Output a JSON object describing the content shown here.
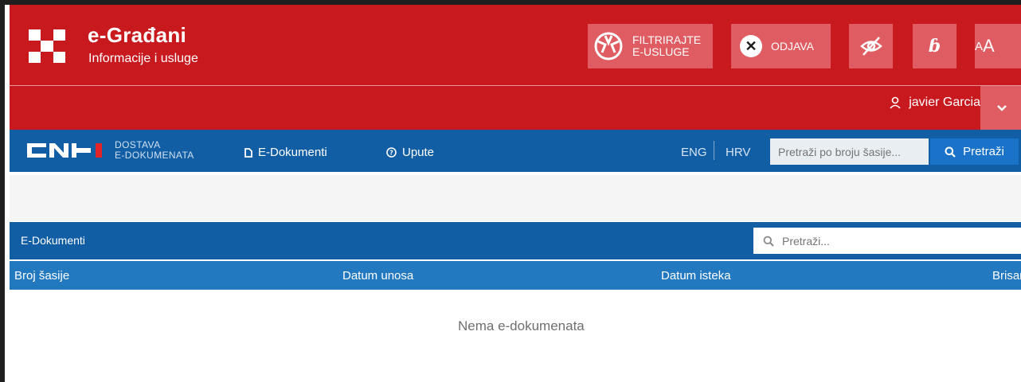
{
  "header": {
    "brand_title": "e-Građani",
    "brand_subtitle": "Informacije i usluge",
    "filter_button": {
      "line1": "FILTRIRAJTE",
      "line2": "E-USLUGE"
    },
    "logout_label": "ODJAVA",
    "aa_small": "A",
    "aa_large": "A",
    "dyslexia_glyph": "ɓ"
  },
  "user": {
    "name": "javier Garcia"
  },
  "nav": {
    "logo_line1": "DOSTAVA",
    "logo_line2": "E-DOKUMENATA",
    "links": [
      {
        "icon": "document-icon",
        "label": "E-Dokumenti"
      },
      {
        "icon": "help-circle-icon",
        "label": "Upute"
      }
    ],
    "lang_eng": "ENG",
    "lang_hrv": "HRV",
    "search_placeholder": "Pretraži po broju šasije...",
    "search_button": "Pretraži"
  },
  "panel": {
    "title": "E-Dokumenti",
    "search_placeholder": "Pretraži...",
    "columns": [
      "Broj šasije",
      "Datum unosa",
      "Datum isteka",
      "Brisanje"
    ],
    "empty_message": "Nema e-dokumenata"
  },
  "colors": {
    "header_red": "#c8191f",
    "header_button": "#df5d62",
    "nav_blue": "#125ea4",
    "column_blue": "#2379c0",
    "search_button_blue": "#1a72c9"
  }
}
